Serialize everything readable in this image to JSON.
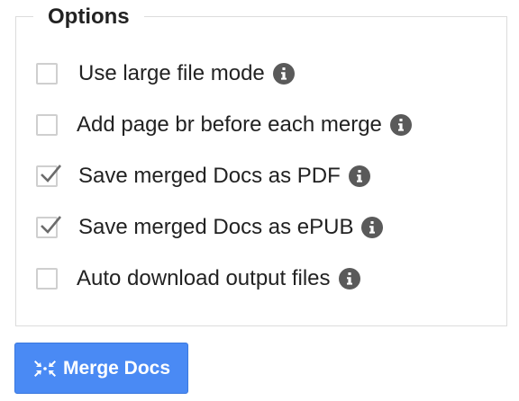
{
  "options": {
    "title": "Options",
    "items": [
      {
        "label": "Use large file mode",
        "checked": false
      },
      {
        "label": "Add page br before each merge",
        "checked": false
      },
      {
        "label": "Save merged Docs as PDF",
        "checked": true
      },
      {
        "label": "Save merged Docs as ePUB",
        "checked": true
      },
      {
        "label": "Auto download output files",
        "checked": false
      }
    ]
  },
  "merge_button": {
    "label": "Merge Docs",
    "icon": "merge-arrows-icon"
  },
  "colors": {
    "button_bg": "#4a8af4",
    "info_icon_bg": "#5a5a5a",
    "text": "#222222",
    "border": "#dcdcdc"
  }
}
